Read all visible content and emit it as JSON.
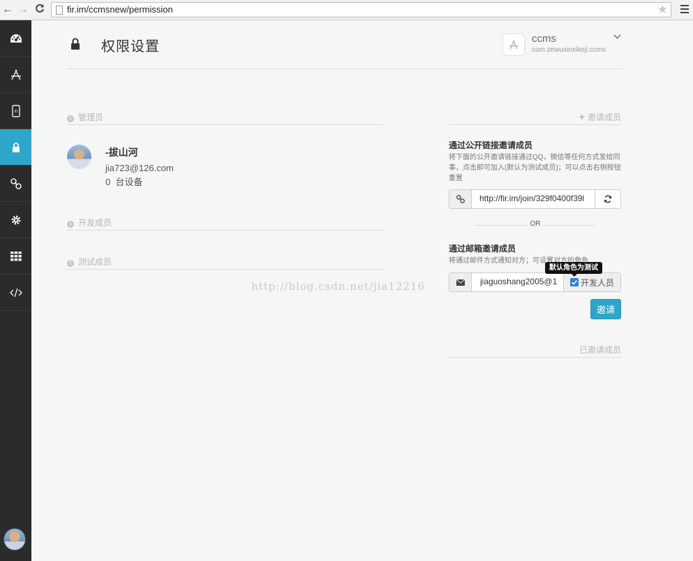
{
  "browser": {
    "url": "fir.im/ccmsnew/permission"
  },
  "sidebar": {
    "items": [
      {
        "icon": "dashboard-icon"
      },
      {
        "icon": "app-store-icon"
      },
      {
        "icon": "device-udid-icon"
      },
      {
        "icon": "lock-icon",
        "active": true
      },
      {
        "icon": "link-icon"
      },
      {
        "icon": "gear-icon"
      },
      {
        "icon": "grid-icon"
      },
      {
        "icon": "code-icon"
      }
    ],
    "accent": "#2ea6c9"
  },
  "header": {
    "title": "权限设置",
    "app_name": "ccms",
    "app_bundle": "com.zewuxinxikeji.ccms"
  },
  "admins": {
    "heading": "管理员",
    "members": [
      {
        "name": "-拔山河",
        "email": "jia723@126.com",
        "devices_count": "0",
        "devices_label": "台设备"
      }
    ]
  },
  "developers": {
    "heading": "开发成员"
  },
  "testers": {
    "heading": "测试成员"
  },
  "invite": {
    "heading": "邀请成员",
    "link": {
      "title": "通过公开链接邀请成员",
      "desc": "将下面的公开邀请链接通过QQ，微信等任何方式发给同事，点击即可加入(默认为测试成员)；可以点击右侧按钮重置",
      "value": "http://fir.im/join/329f0400f39l"
    },
    "or_label": "OR",
    "email": {
      "title": "通过邮箱邀请成员",
      "desc": "将通过邮件方式通知对方；可设置对方的角色",
      "value": "jiaguoshang2005@1",
      "role_label": "开发人员",
      "role_checked": true,
      "tooltip": "默认角色为测试"
    },
    "button_label": "邀请",
    "invited_heading": "已邀请成员"
  },
  "watermark": "http://blog.csdn.net/jia12216"
}
